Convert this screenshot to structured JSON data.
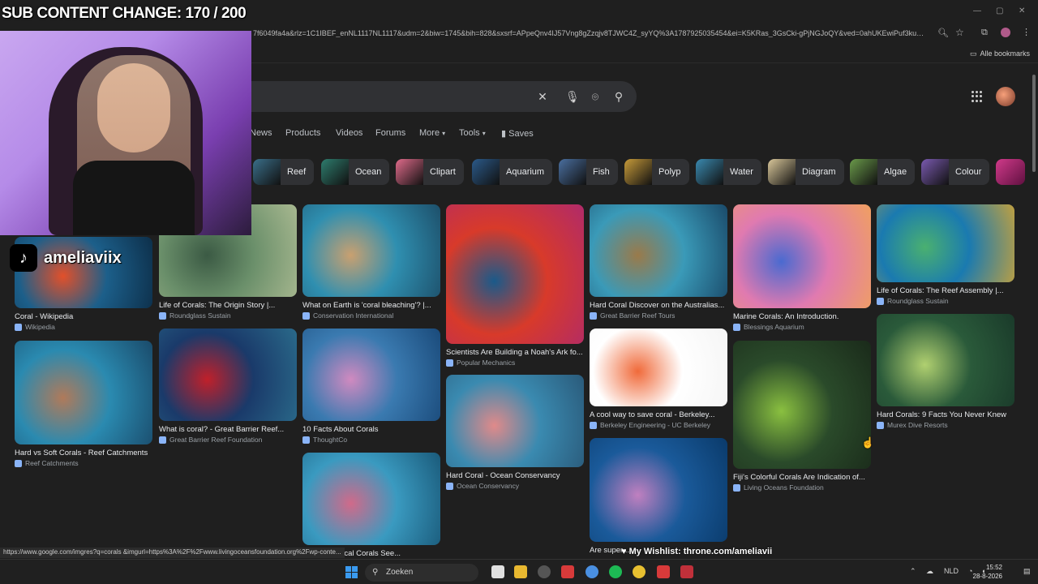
{
  "browser": {
    "url": "7f6049fa4a&rlz=1C1IBEF_enNL1117NL1117&udm=2&biw=1745&bih=828&sxsrf=APpeQnv4IJ57Vng8gZzqjv8TJWC4Z_syYQ%3A1787925035454&ei=K5KRas_3GsCki-gPjNGJoQY&ved=0ahUKEwiPuf3ku8...",
    "bookmarks_label": "Alle bookmarks",
    "status_url": "https://www.google.com/imgres?q=corals &imgurl=https%3A%2F%2Fwww.livingoceansfoundation.org%2Fwp-conte..."
  },
  "tabs": [
    "News",
    "Products",
    "Videos",
    "Forums",
    "More",
    "Tools",
    "Saves"
  ],
  "chips": [
    {
      "label": "Reef",
      "color": "#3a6f8a"
    },
    {
      "label": "Ocean",
      "color": "#2e7d6e"
    },
    {
      "label": "Clipart",
      "color": "#e06b8b"
    },
    {
      "label": "Aquarium",
      "color": "#2b5a8a"
    },
    {
      "label": "Fish",
      "color": "#4a6fa0"
    },
    {
      "label": "Polyp",
      "color": "#c79b3a"
    },
    {
      "label": "Water",
      "color": "#3a8ab0"
    },
    {
      "label": "Diagram",
      "color": "#d9c79a"
    },
    {
      "label": "Algae",
      "color": "#6a9a4a"
    },
    {
      "label": "Colour",
      "color": "#7a5ab0"
    }
  ],
  "results": [
    {
      "caption": "Coral - Wikipedia",
      "source": "Wikipedia",
      "colors": [
        "#1c5f8a",
        "#e2502a",
        "#0d2f4a"
      ]
    },
    {
      "caption": "Life of Corals: The Origin Story |...",
      "source": "Roundglass Sustain",
      "colors": [
        "#6a8f6a",
        "#3b5a44",
        "#a8b890"
      ]
    },
    {
      "caption": "What on Earth is 'coral bleaching'? |...",
      "source": "Conservation International",
      "colors": [
        "#2f8fb0",
        "#c9a070",
        "#1d4f6a"
      ]
    },
    {
      "caption": "Scientists Are Building a Noah's Ark fo...",
      "source": "Popular Mechanics",
      "colors": [
        "#d83a2a",
        "#1a5a8a",
        "#b02a6a"
      ]
    },
    {
      "caption": "Hard Coral Discover on the Australias...",
      "source": "Great Barrier Reef Tours",
      "colors": [
        "#3a9ab8",
        "#9a7a4a",
        "#1a4a6a"
      ]
    },
    {
      "caption": "Marine Corals: An Introduction.",
      "source": "Blessings Aquarium",
      "colors": [
        "#e07ab0",
        "#4a6ad0",
        "#f0a060"
      ]
    },
    {
      "caption": "Life of Corals: The Reef Assembly |...",
      "source": "Roundglass Sustain",
      "colors": [
        "#1a7ab0",
        "#4ab070",
        "#c0a040"
      ]
    },
    {
      "caption": "Hard vs Soft Corals - Reef Catchments",
      "source": "Reef Catchments",
      "colors": [
        "#2a8ab0",
        "#b07a5a",
        "#1a4a6a"
      ]
    },
    {
      "caption": "What is coral? - Great Barrier Reef...",
      "source": "Great Barrier Reef Foundation",
      "colors": [
        "#1a3a6a",
        "#c0202a",
        "#2a6a8a"
      ]
    },
    {
      "caption": "10 Facts About Corals",
      "source": "ThoughtCo",
      "colors": [
        "#3a7ab0",
        "#d08ac0",
        "#1a4a7a"
      ]
    },
    {
      "caption": "A cool way to save coral - Berkeley...",
      "source": "Berkeley Engineering - UC Berkeley",
      "colors": [
        "#ffffff",
        "#f06a3a",
        "#f5f5f5"
      ]
    },
    {
      "caption": "Fiji's Colorful Corals Are Indication of...",
      "source": "Living Oceans Foundation",
      "colors": [
        "#2a4a2a",
        "#8ac040",
        "#1a2a1a"
      ]
    },
    {
      "caption": "Hard Corals: 9 Facts You Never Knew",
      "source": "Murex Dive Resorts",
      "colors": [
        "#2a5a3a",
        "#b0d070",
        "#1a3a2a"
      ]
    },
    {
      "caption": "Hard Coral - Ocean Conservancy",
      "source": "Ocean Conservancy",
      "colors": [
        "#3a8ab0",
        "#e08a8a",
        "#2a5a7a"
      ]
    },
    {
      "caption": "Are super ...",
      "source": "",
      "colors": [
        "#1a5a9a",
        "#c080c0",
        "#0a3a6a"
      ]
    },
    {
      "caption": "Warm, Tropical Corals See...",
      "source": "",
      "colors": [
        "#3a9ac0",
        "#d06a8a",
        "#1a5a7a"
      ]
    }
  ],
  "overlay": {
    "sub_banner": "SUB CONTENT CHANGE: 170 / 200",
    "tiktok_handle": "ameliaviix",
    "wishlist": "My Wishlist: throne.com/ameliavii"
  },
  "taskbar": {
    "search_label": "Zoeken",
    "language": "NLD",
    "time": "15:52",
    "date": "28-8-2026"
  }
}
